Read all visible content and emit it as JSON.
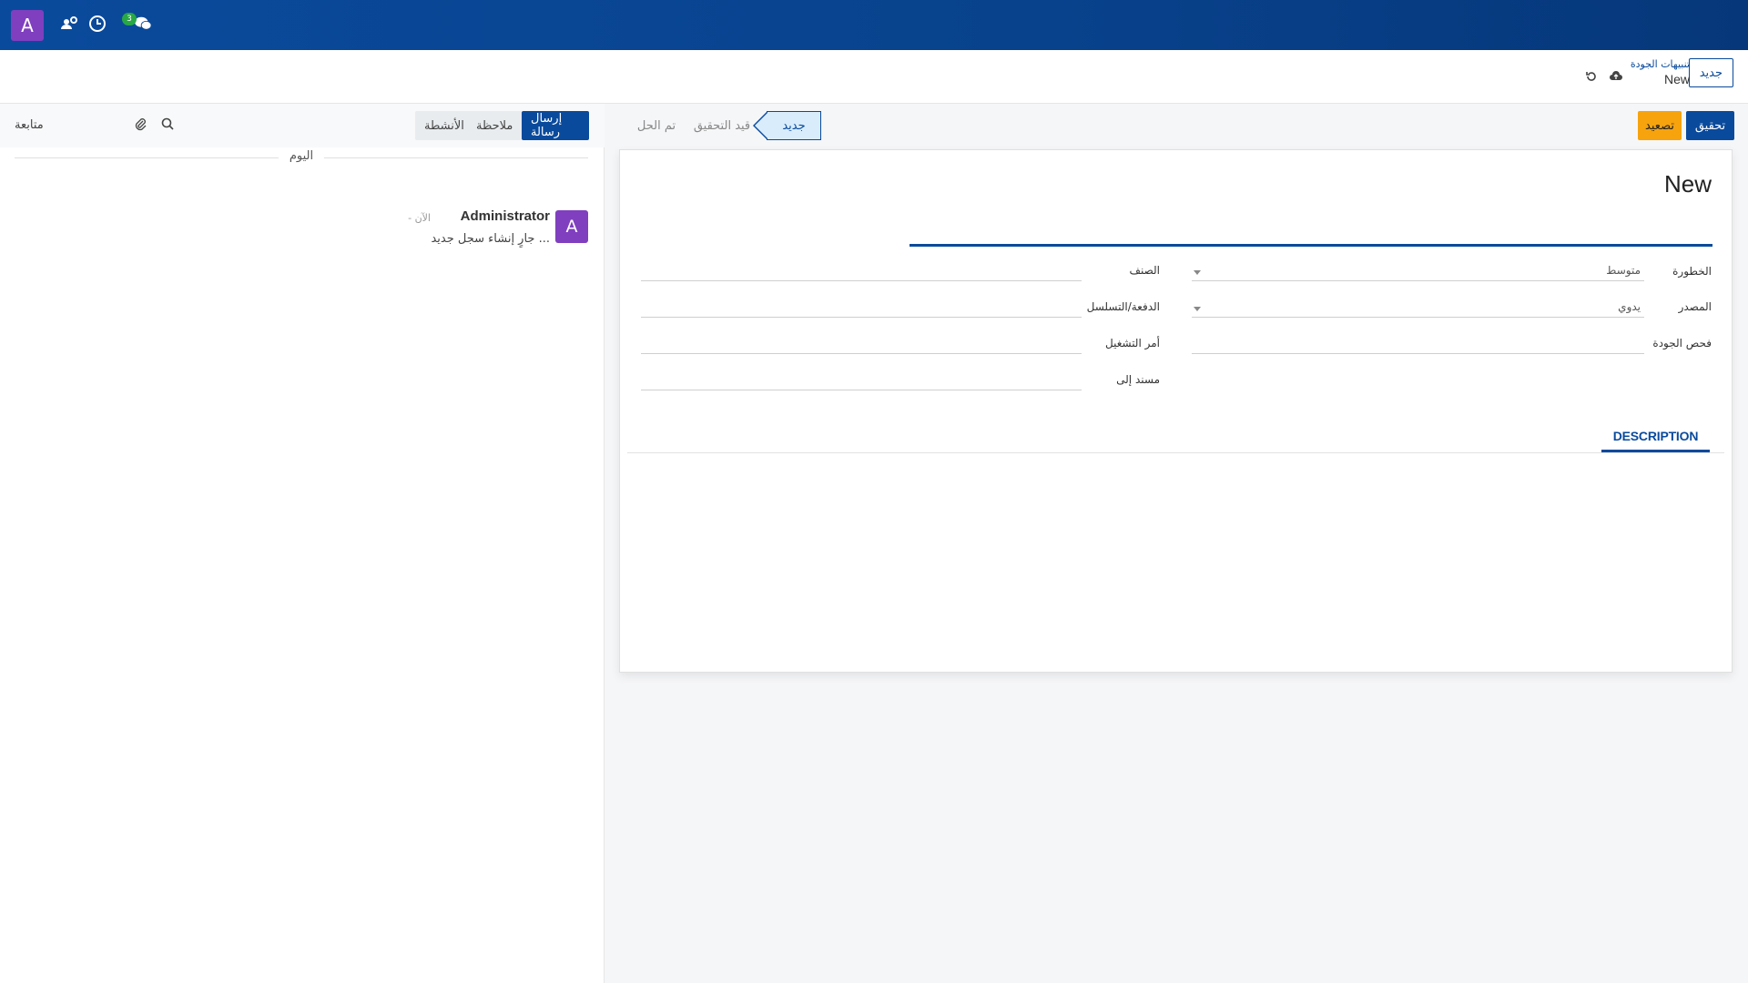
{
  "navbar": {
    "avatar_letter": "A",
    "icons": [
      "users-gear-icon",
      "clock-icon",
      "chat-icon"
    ],
    "chat_badge": "3"
  },
  "control_panel": {
    "new_button": "جديد",
    "breadcrumb_parent": "تنبيهات الجودة",
    "breadcrumb_current": "New"
  },
  "chatter": {
    "send_message": "إرسال رسالة",
    "log_note": "ملاحظة",
    "activities": "الأنشطة",
    "follow": "متابعة",
    "day_separator": "اليوم",
    "message": {
      "avatar_letter": "A",
      "author": "Administrator",
      "time": "- الآن",
      "body": "جارٍ إنشاء سجل جديد ..."
    }
  },
  "statusbar": {
    "actions": {
      "investigate": "تحقيق",
      "escalate": "تصعيد"
    },
    "stages": [
      {
        "label": "جديد",
        "active": true
      },
      {
        "label": "قيد التحقيق",
        "active": false
      },
      {
        "label": "تم الحل",
        "active": false
      }
    ]
  },
  "form": {
    "title": "New",
    "fields_right": [
      {
        "label": "الخطورة",
        "value": "متوسط"
      },
      {
        "label": "المصدر",
        "value": "يدوي"
      },
      {
        "label": "فحص الجودة",
        "value": ""
      }
    ],
    "fields_left": [
      {
        "label": "الصنف",
        "value": ""
      },
      {
        "label": "الدفعة/التسلسل",
        "value": ""
      },
      {
        "label": "أمر التشغيل",
        "value": ""
      },
      {
        "label": "مسند إلى",
        "value": ""
      }
    ],
    "tab_description": "DESCRIPTION"
  },
  "colors": {
    "navbar": "#0a4a9c",
    "avatar": "#7f3fbf",
    "badge": "#28a745",
    "warning": "#f6a30e"
  }
}
